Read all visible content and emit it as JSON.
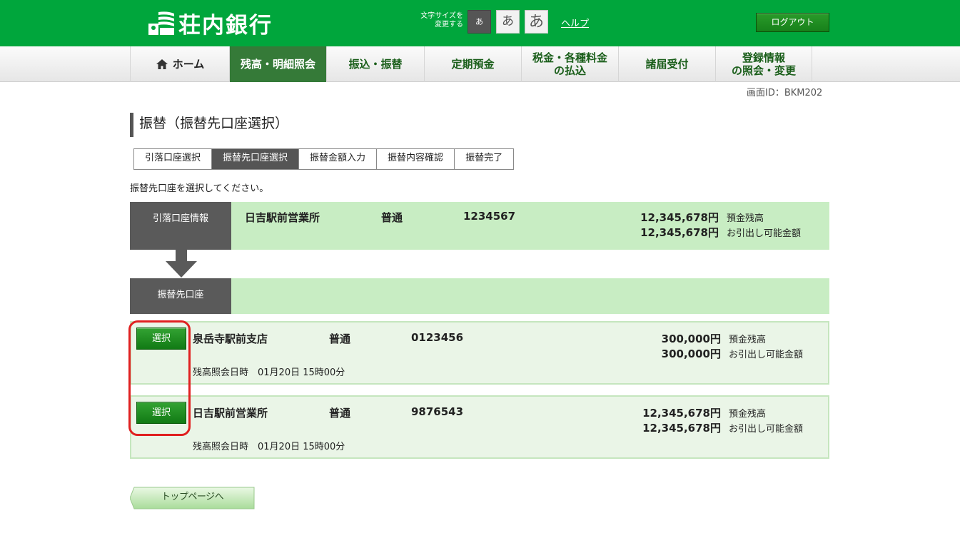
{
  "header": {
    "bank_name": "荘内銀行",
    "fontsize_label_line1": "文字サイズを",
    "fontsize_label_line2": "変更する",
    "fontsize_small": "あ",
    "fontsize_medium": "あ",
    "fontsize_large": "あ",
    "help": "ヘルプ",
    "logout": "ログアウト"
  },
  "nav": {
    "items": [
      {
        "label": "ホーム"
      },
      {
        "label": "残高・明細照会"
      },
      {
        "label": "振込・振替"
      },
      {
        "label": "定期預金"
      },
      {
        "label_line1": "税金・各種料金",
        "label_line2": "の払込"
      },
      {
        "label": "諸届受付"
      },
      {
        "label_line1": "登録情報",
        "label_line2": "の照会・変更"
      }
    ],
    "active_index": 1
  },
  "screen_id": "画面ID：BKM202",
  "page_title": "振替（振替先口座選択）",
  "steps": [
    "引落口座選択",
    "振替先口座選択",
    "振替金額入力",
    "振替内容確認",
    "振替完了"
  ],
  "active_step": 1,
  "instruction": "振替先口座を選択してください。",
  "source": {
    "label": "引落口座情報",
    "branch": "日吉駅前営業所",
    "type": "普通",
    "number": "1234567",
    "balance": "12,345,678円",
    "balance_label": "預金残高",
    "available": "12,345,678円",
    "available_label": "お引出し可能金額"
  },
  "dest_label": "振替先口座",
  "accounts": [
    {
      "select": "選択",
      "branch": "泉岳寺駅前支店",
      "type": "普通",
      "number": "0123456",
      "balance": "300,000円",
      "balance_label": "預金残高",
      "available": "300,000円",
      "available_label": "お引出し可能金額",
      "inquiry": "残高照会日時　01月20日 15時00分"
    },
    {
      "select": "選択",
      "branch": "日吉駅前営業所",
      "type": "普通",
      "number": "9876543",
      "balance": "12,345,678円",
      "balance_label": "預金残高",
      "available": "12,345,678円",
      "available_label": "お引出し可能金額",
      "inquiry": "残高照会日時　01月20日 15時00分"
    }
  ],
  "top_page_button": "トップページへ",
  "colors": {
    "brand_green": "#00a63c",
    "panel_green": "#c8edc3",
    "row_green": "#eaf5e7",
    "highlight_red": "#e02020"
  }
}
